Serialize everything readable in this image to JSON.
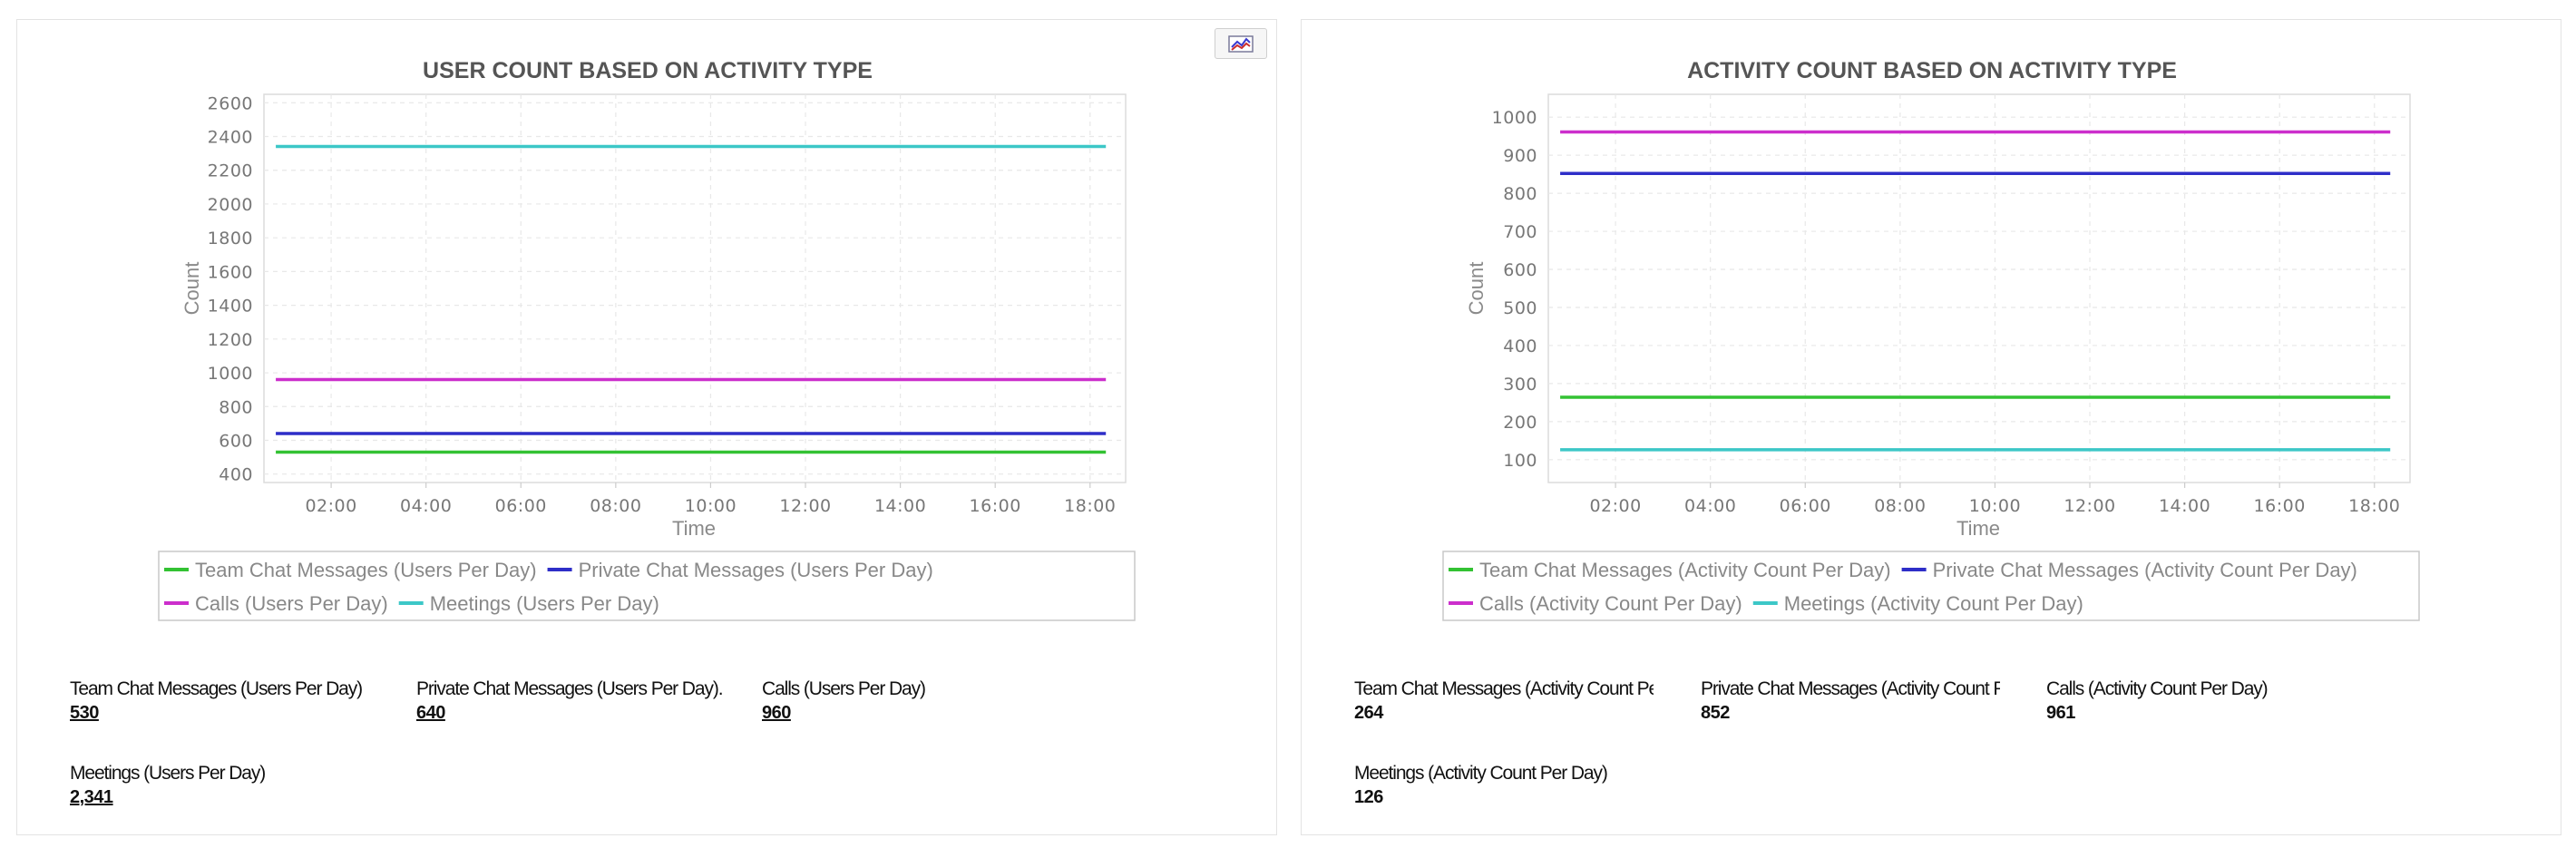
{
  "colors": {
    "team_chat": "#33c233",
    "private_chat": "#2e2ec8",
    "calls": "#cc2ecc",
    "meetings": "#3cc7c7"
  },
  "icons": {
    "export": "chart-export-icon"
  },
  "charts": [
    {
      "title": "USER COUNT BASED ON ACTIVITY TYPE",
      "ylabel": "Count",
      "xlabel": "Time",
      "y_ticks": [
        "400",
        "600",
        "800",
        "1000",
        "1200",
        "1400",
        "1600",
        "1800",
        "2000",
        "2200",
        "2400",
        "2600"
      ],
      "x_ticks": [
        "02:00",
        "04:00",
        "06:00",
        "08:00",
        "10:00",
        "12:00",
        "14:00",
        "16:00",
        "18:00"
      ],
      "legend": [
        "Team Chat Messages (Users Per Day)",
        "Private Chat Messages (Users Per Day)",
        "Calls (Users Per Day)",
        "Meetings (Users Per Day)"
      ]
    },
    {
      "title": "ACTIVITY COUNT BASED ON ACTIVITY TYPE",
      "ylabel": "Count",
      "xlabel": "Time",
      "y_ticks": [
        "100",
        "200",
        "300",
        "400",
        "500",
        "600",
        "700",
        "800",
        "900",
        "1000"
      ],
      "x_ticks": [
        "02:00",
        "04:00",
        "06:00",
        "08:00",
        "10:00",
        "12:00",
        "14:00",
        "16:00",
        "18:00"
      ],
      "legend": [
        "Team Chat Messages (Activity Count Per Day)",
        "Private Chat Messages (Activity Count Per Day)",
        "Calls (Activity Count Per Day)",
        "Meetings (Activity Count Per Day)"
      ]
    }
  ],
  "chart_data": [
    {
      "type": "line",
      "title": "USER COUNT BASED ON ACTIVITY TYPE",
      "xlabel": "Time",
      "ylabel": "Count",
      "x_range": [
        "00:50",
        "18:20"
      ],
      "ylim": [
        300,
        2600
      ],
      "grid": true,
      "legend_position": "bottom",
      "series": [
        {
          "name": "Team Chat Messages (Users Per Day)",
          "color": "#33c233",
          "x": [
            "00:50",
            "18:20"
          ],
          "values": [
            530,
            530
          ]
        },
        {
          "name": "Private Chat Messages (Users Per Day)",
          "color": "#2e2ec8",
          "x": [
            "00:50",
            "18:20"
          ],
          "values": [
            640,
            640
          ]
        },
        {
          "name": "Calls (Users Per Day)",
          "color": "#cc2ecc",
          "x": [
            "00:50",
            "18:20"
          ],
          "values": [
            960,
            960
          ]
        },
        {
          "name": "Meetings (Users Per Day)",
          "color": "#3cc7c7",
          "x": [
            "00:50",
            "18:20"
          ],
          "values": [
            2341,
            2341
          ]
        }
      ]
    },
    {
      "type": "line",
      "title": "ACTIVITY COUNT BASED ON ACTIVITY TYPE",
      "xlabel": "Time",
      "ylabel": "Count",
      "x_range": [
        "00:50",
        "18:20"
      ],
      "ylim": [
        50,
        1050
      ],
      "grid": true,
      "legend_position": "bottom",
      "series": [
        {
          "name": "Team Chat Messages (Activity Count Per Day)",
          "color": "#33c233",
          "x": [
            "00:50",
            "18:20"
          ],
          "values": [
            264,
            264
          ]
        },
        {
          "name": "Private Chat Messages (Activity Count Per Day)",
          "color": "#2e2ec8",
          "x": [
            "00:50",
            "18:20"
          ],
          "values": [
            852,
            852
          ]
        },
        {
          "name": "Calls (Activity Count Per Day)",
          "color": "#cc2ecc",
          "x": [
            "00:50",
            "18:20"
          ],
          "values": [
            961,
            961
          ]
        },
        {
          "name": "Meetings (Activity Count Per Day)",
          "color": "#3cc7c7",
          "x": [
            "00:50",
            "18:20"
          ],
          "values": [
            126,
            126
          ]
        }
      ]
    }
  ],
  "stats": {
    "left": [
      {
        "label": "Team Chat Messages (Users Per Day)",
        "value": "530"
      },
      {
        "label": "Private Chat Messages (Users Per Day).",
        "value": "640"
      },
      {
        "label": "Calls (Users Per Day)",
        "value": "960"
      },
      {
        "label": "Meetings (Users Per Day)",
        "value": "2,341"
      }
    ],
    "right": [
      {
        "label": "Team Chat Messages (Activity Count Per",
        "value": "264"
      },
      {
        "label": "Private Chat Messages (Activity Count Pe",
        "value": "852"
      },
      {
        "label": "Calls (Activity Count Per Day)",
        "value": "961"
      },
      {
        "label": "Meetings (Activity Count Per Day)",
        "value": "126"
      }
    ]
  }
}
